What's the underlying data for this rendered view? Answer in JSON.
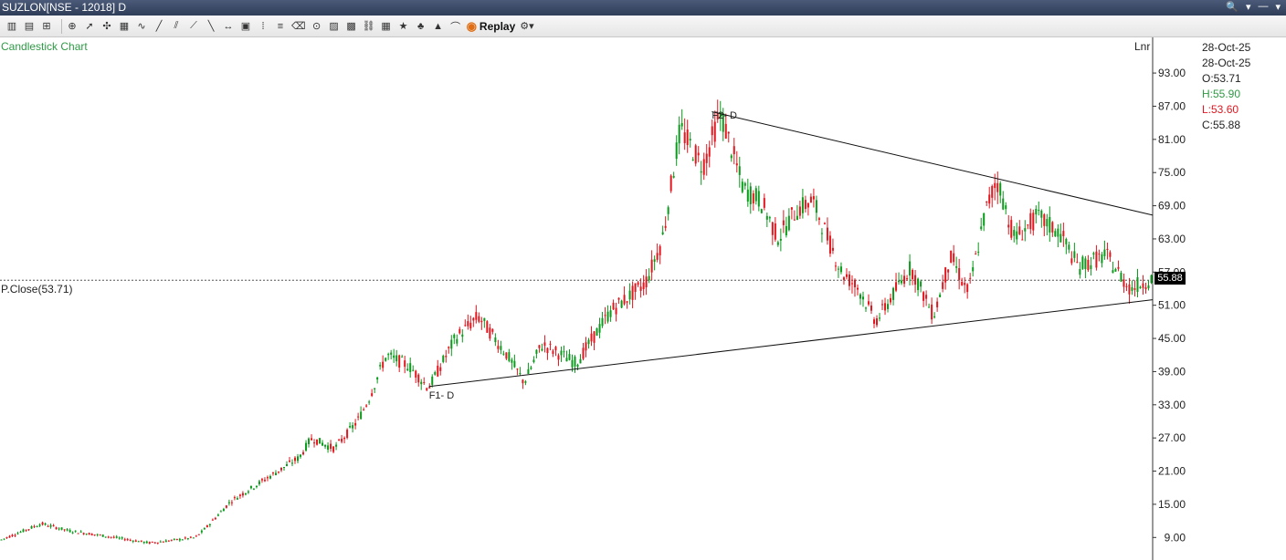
{
  "window": {
    "title": "SUZLON[NSE - 12018] D",
    "controls": [
      "🔍",
      "▾",
      "—",
      "▾"
    ]
  },
  "toolbar": {
    "replay_label": "Replay",
    "icons": [
      "bar-chart-icon",
      "candle-chart-icon",
      "line-chart-icon",
      "pan-icon",
      "pointer-icon",
      "crosshair-icon",
      "zoom-icon",
      "indicator-icon",
      "trendline-icon",
      "channel-icon",
      "fib-icon",
      "ray-icon",
      "horizontal-line-icon",
      "box-icon",
      "text-icon",
      "gann-icon",
      "eraser-icon",
      "magnet-icon",
      "calendar-icon",
      "alert-icon",
      "save-icon",
      "link-icon",
      "star-icon",
      "bell-icon",
      "flag-icon",
      "compare-icon"
    ]
  },
  "chart": {
    "label": "Candlestick Chart",
    "scale_mode": "Lnr",
    "prev_close_label": "P.Close(53.71)",
    "current_price_tag": "55.88",
    "ohlc": {
      "date1": "28-Oct-25",
      "date2": "28-Oct-25",
      "open": "O:53.71",
      "high": "H:55.90",
      "low": "L:53.60",
      "close": "C:55.88"
    },
    "pattern_labels": {
      "point1": "F1- D",
      "point2": "F2- D"
    },
    "colors": {
      "up": "#0a9a1c",
      "down": "#e2161e",
      "label_green": "#2e9a45",
      "high": "#2e9a45",
      "low": "#e2161e"
    }
  },
  "chart_data": {
    "type": "candlestick",
    "title": "Candlestick Chart",
    "y_tick_labels": [
      "93.00",
      "87.00",
      "81.00",
      "75.00",
      "69.00",
      "63.00",
      "57.00",
      "51.00",
      "45.00",
      "39.00",
      "33.00",
      "27.00",
      "21.00",
      "15.00",
      "9.00"
    ],
    "ylim": [
      7,
      96
    ],
    "grid": false,
    "previous_close": 53.71,
    "last_price": 55.88,
    "trendlines": [
      {
        "name": "upper",
        "from": {
          "x_frac": 0.6176,
          "y": 86.0
        },
        "to": {
          "x_frac": 1.0,
          "y": 67.3
        }
      },
      {
        "name": "lower",
        "from": {
          "x_frac": 0.3722,
          "y": 36.3
        },
        "to": {
          "x_frac": 1.0,
          "y": 52.0
        }
      }
    ],
    "price_path": [
      [
        0.0,
        8.5
      ],
      [
        0.036,
        11.5
      ],
      [
        0.06,
        10.2
      ],
      [
        0.09,
        9.3
      ],
      [
        0.13,
        8.0
      ],
      [
        0.17,
        9.0
      ],
      [
        0.18,
        11.0
      ],
      [
        0.2,
        15.5
      ],
      [
        0.23,
        19.5
      ],
      [
        0.26,
        23.5
      ],
      [
        0.27,
        27.0
      ],
      [
        0.29,
        25.0
      ],
      [
        0.31,
        30.0
      ],
      [
        0.32,
        34.0
      ],
      [
        0.335,
        42.0
      ],
      [
        0.355,
        40.0
      ],
      [
        0.372,
        36.0
      ],
      [
        0.395,
        45.0
      ],
      [
        0.415,
        49.0
      ],
      [
        0.44,
        42.0
      ],
      [
        0.455,
        37.0
      ],
      [
        0.47,
        44.0
      ],
      [
        0.5,
        40.5
      ],
      [
        0.53,
        50.0
      ],
      [
        0.56,
        55.0
      ],
      [
        0.575,
        63.0
      ],
      [
        0.59,
        83.0
      ],
      [
        0.61,
        76.0
      ],
      [
        0.625,
        86.0
      ],
      [
        0.645,
        72.0
      ],
      [
        0.66,
        70.0
      ],
      [
        0.675,
        63.0
      ],
      [
        0.69,
        68.0
      ],
      [
        0.705,
        70.0
      ],
      [
        0.73,
        57.0
      ],
      [
        0.745,
        54.0
      ],
      [
        0.76,
        48.0
      ],
      [
        0.79,
        58.0
      ],
      [
        0.81,
        49.0
      ],
      [
        0.825,
        60.0
      ],
      [
        0.84,
        53.0
      ],
      [
        0.855,
        68.0
      ],
      [
        0.865,
        74.0
      ],
      [
        0.88,
        63.0
      ],
      [
        0.9,
        67.0
      ],
      [
        0.92,
        64.0
      ],
      [
        0.935,
        58.0
      ],
      [
        0.96,
        60.0
      ],
      [
        0.98,
        54.0
      ],
      [
        1.0,
        55.9
      ]
    ]
  }
}
